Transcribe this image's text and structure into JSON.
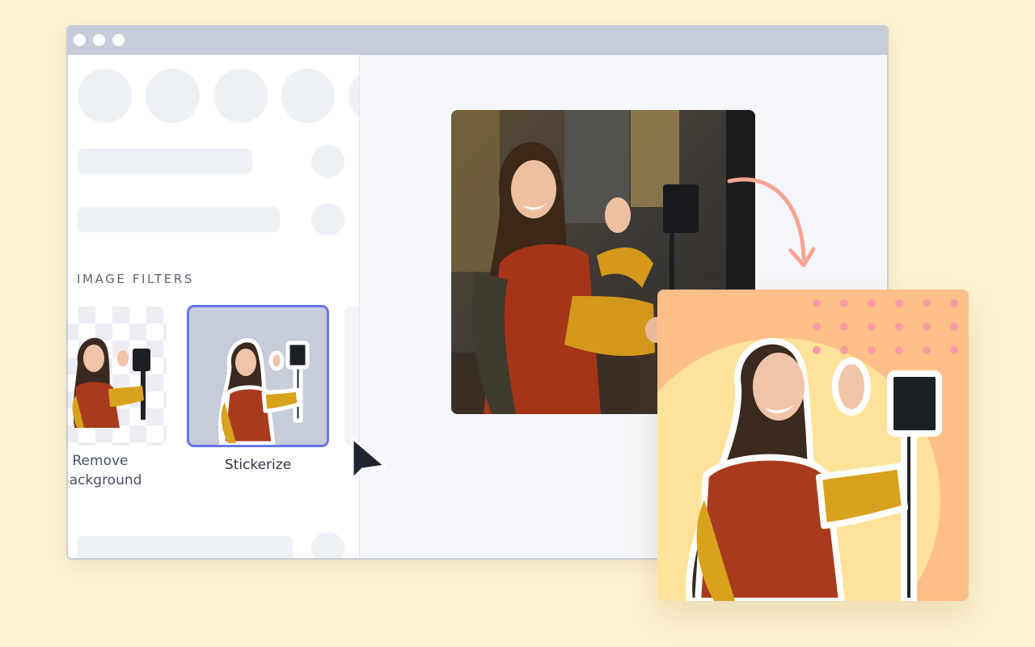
{
  "sidebar": {
    "section_title": "IMAGE FILTERS",
    "filters": [
      {
        "label": "Remove\nBackground",
        "selected": false
      },
      {
        "label": "Stickerize",
        "selected": true
      }
    ]
  },
  "colors": {
    "page_background": "#fdf3d3",
    "window_chrome": "#c7ccda",
    "selected_outline": "#6875e6",
    "result_background": "#ffbf86",
    "result_circle": "#ffe29a",
    "dots": "#f99ba3",
    "arrow": "#f7a392"
  },
  "icons": {
    "cursor": "mouse-pointer-icon",
    "arrow": "curved-arrow-icon"
  }
}
